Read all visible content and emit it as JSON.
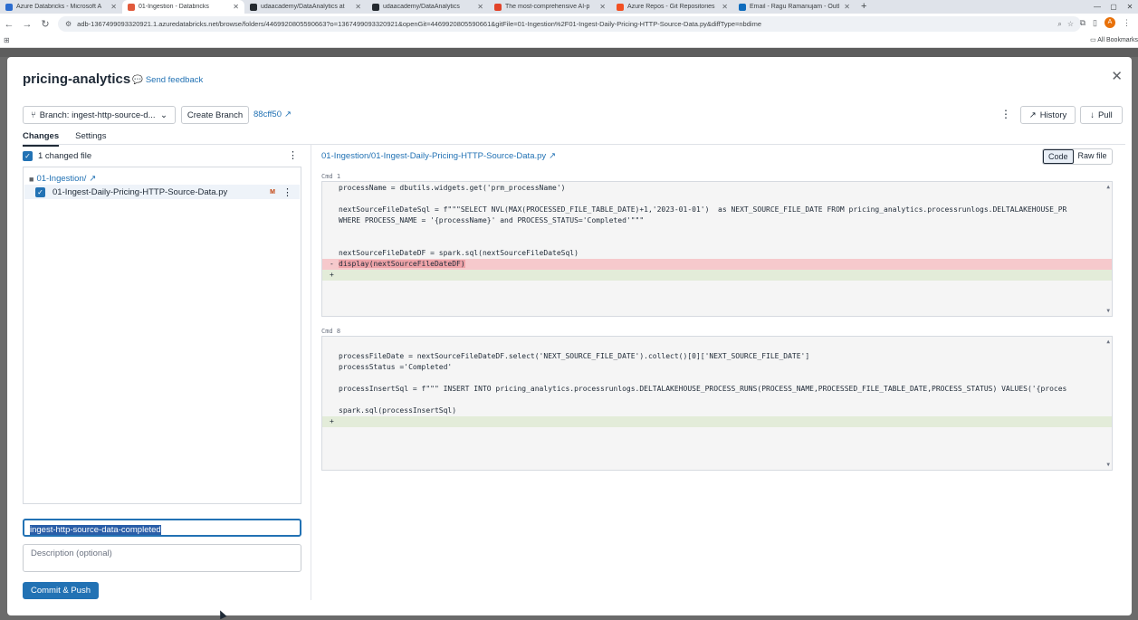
{
  "browser": {
    "tabs": [
      {
        "label": "Azure Databricks - Microsoft A",
        "icon": "azure-icon",
        "color": "#2b6ccf",
        "active": false
      },
      {
        "label": "01-Ingestion - Databricks",
        "icon": "databricks-icon",
        "color": "#e15a3c",
        "active": true
      },
      {
        "label": "udaacademy/DataAnalytics at",
        "icon": "github-icon",
        "color": "#24292f",
        "active": false
      },
      {
        "label": "udaacademy/DataAnalytics",
        "icon": "github-icon",
        "color": "#24292f",
        "active": false
      },
      {
        "label": "The most-comprehensive AI-p",
        "icon": "gitlab-icon",
        "color": "#e24329",
        "active": false
      },
      {
        "label": "Azure Repos - Git Repositories",
        "icon": "microsoft-icon",
        "color": "#f25022",
        "active": false
      },
      {
        "label": "Email - Ragu Ramanujam - Outl",
        "icon": "outlook-icon",
        "color": "#0f6cbd",
        "active": false
      }
    ],
    "url": "adb-1367499093320921.1.azuredatabricks.net/browse/folders/4469920805590663?o=1367499093320921&openGit=4469920805590661&gitFile=01-Ingestion%2F01-Ingest-Daily-Pricing-HTTP-Source-Data.py&diffType=nbdime",
    "avatar_letter": "A",
    "all_bookmarks": "All Bookmarks"
  },
  "modal": {
    "title": "pricing-analytics",
    "feedback": "Send feedback",
    "branch_label": "Branch: ingest-http-source-d...",
    "create_branch": "Create Branch",
    "commit_hash": "88cff50",
    "history": "History",
    "pull": "Pull",
    "tabs": [
      "Changes",
      "Settings"
    ],
    "changed_files_label": "1 changed file",
    "folder": "01-Ingestion/",
    "file": "01-Ingest-Daily-Pricing-HTTP-Source-Data.py",
    "file_status": "M",
    "commit_message": "ingest-http-source-data-completed",
    "description_placeholder": "Description (optional)",
    "commit_button": "Commit & Push"
  },
  "diff": {
    "path": "01-Ingestion/01-Ingest-Daily-Pricing-HTTP-Source-Data.py",
    "view_code": "Code",
    "view_raw": "Raw file",
    "cells": [
      {
        "cmd": "Cmd 1",
        "lines": [
          {
            "type": "ctx",
            "text": "processName = dbutils.widgets.get('prm_processName')"
          },
          {
            "type": "ctx",
            "text": ""
          },
          {
            "type": "ctx",
            "text": "nextSourceFileDateSql = f\"\"\"SELECT NVL(MAX(PROCESSED_FILE_TABLE_DATE)+1,'2023-01-01')  as NEXT_SOURCE_FILE_DATE FROM pricing_analytics.processrunlogs.DELTALAKEHOUSE_PR"
          },
          {
            "type": "ctx",
            "text": "WHERE PROCESS_NAME = '{processName}' and PROCESS_STATUS='Completed'\"\"\""
          },
          {
            "type": "ctx",
            "text": ""
          },
          {
            "type": "ctx",
            "text": ""
          },
          {
            "type": "ctx",
            "text": "nextSourceFileDateDF = spark.sql(nextSourceFileDateSql)"
          },
          {
            "type": "del",
            "text": "display(nextSourceFileDateDF)"
          },
          {
            "type": "add",
            "text": ""
          }
        ]
      },
      {
        "cmd": "Cmd 8",
        "lines": [
          {
            "type": "ctx",
            "text": ""
          },
          {
            "type": "ctx",
            "text": "processFileDate = nextSourceFileDateDF.select('NEXT_SOURCE_FILE_DATE').collect()[0]['NEXT_SOURCE_FILE_DATE']"
          },
          {
            "type": "ctx",
            "text": "processStatus ='Completed'"
          },
          {
            "type": "ctx",
            "text": ""
          },
          {
            "type": "ctx",
            "text": "processInsertSql = f\"\"\" INSERT INTO pricing_analytics.processrunlogs.DELTALAKEHOUSE_PROCESS_RUNS(PROCESS_NAME,PROCESSED_FILE_TABLE_DATE,PROCESS_STATUS) VALUES('{proces"
          },
          {
            "type": "ctx",
            "text": ""
          },
          {
            "type": "ctx",
            "text": "spark.sql(processInsertSql)"
          },
          {
            "type": "add",
            "text": ""
          }
        ]
      }
    ]
  }
}
